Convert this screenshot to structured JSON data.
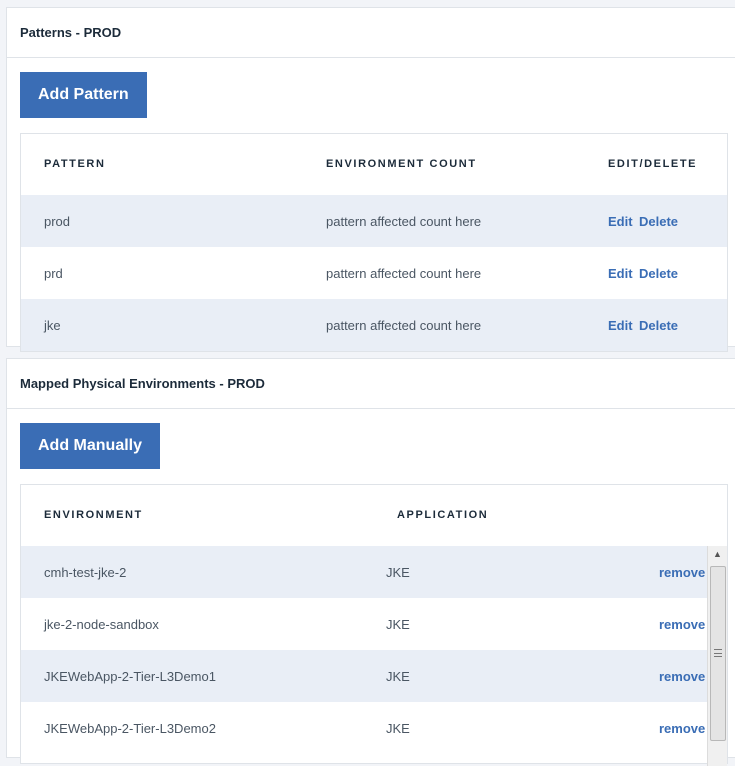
{
  "patterns_panel": {
    "title": "Patterns - PROD",
    "add_button": "Add Pattern",
    "columns": [
      "PATTERN",
      "ENVIRONMENT COUNT",
      "EDIT/DELETE"
    ],
    "rows": [
      {
        "pattern": "prod",
        "count": "pattern affected count here",
        "edit": "Edit",
        "delete": "Delete"
      },
      {
        "pattern": "prd",
        "count": "pattern affected count here",
        "edit": "Edit",
        "delete": "Delete"
      },
      {
        "pattern": "jke",
        "count": "pattern affected count here",
        "edit": "Edit",
        "delete": "Delete"
      }
    ]
  },
  "environments_panel": {
    "title": "Mapped Physical Environments - PROD",
    "add_button": "Add Manually",
    "columns": [
      "ENVIRONMENT",
      "APPLICATION"
    ],
    "rows": [
      {
        "environment": "cmh-test-jke-2",
        "application": "JKE",
        "action": "remove"
      },
      {
        "environment": "jke-2-node-sandbox",
        "application": "JKE",
        "action": "remove"
      },
      {
        "environment": "JKEWebApp-2-Tier-L3Demo1",
        "application": "JKE",
        "action": "remove"
      },
      {
        "environment": "JKEWebApp-2-Tier-L3Demo2",
        "application": "JKE",
        "action": "remove"
      }
    ]
  },
  "colors": {
    "accent": "#3a6db5",
    "row_alt": "#e9eef6"
  }
}
